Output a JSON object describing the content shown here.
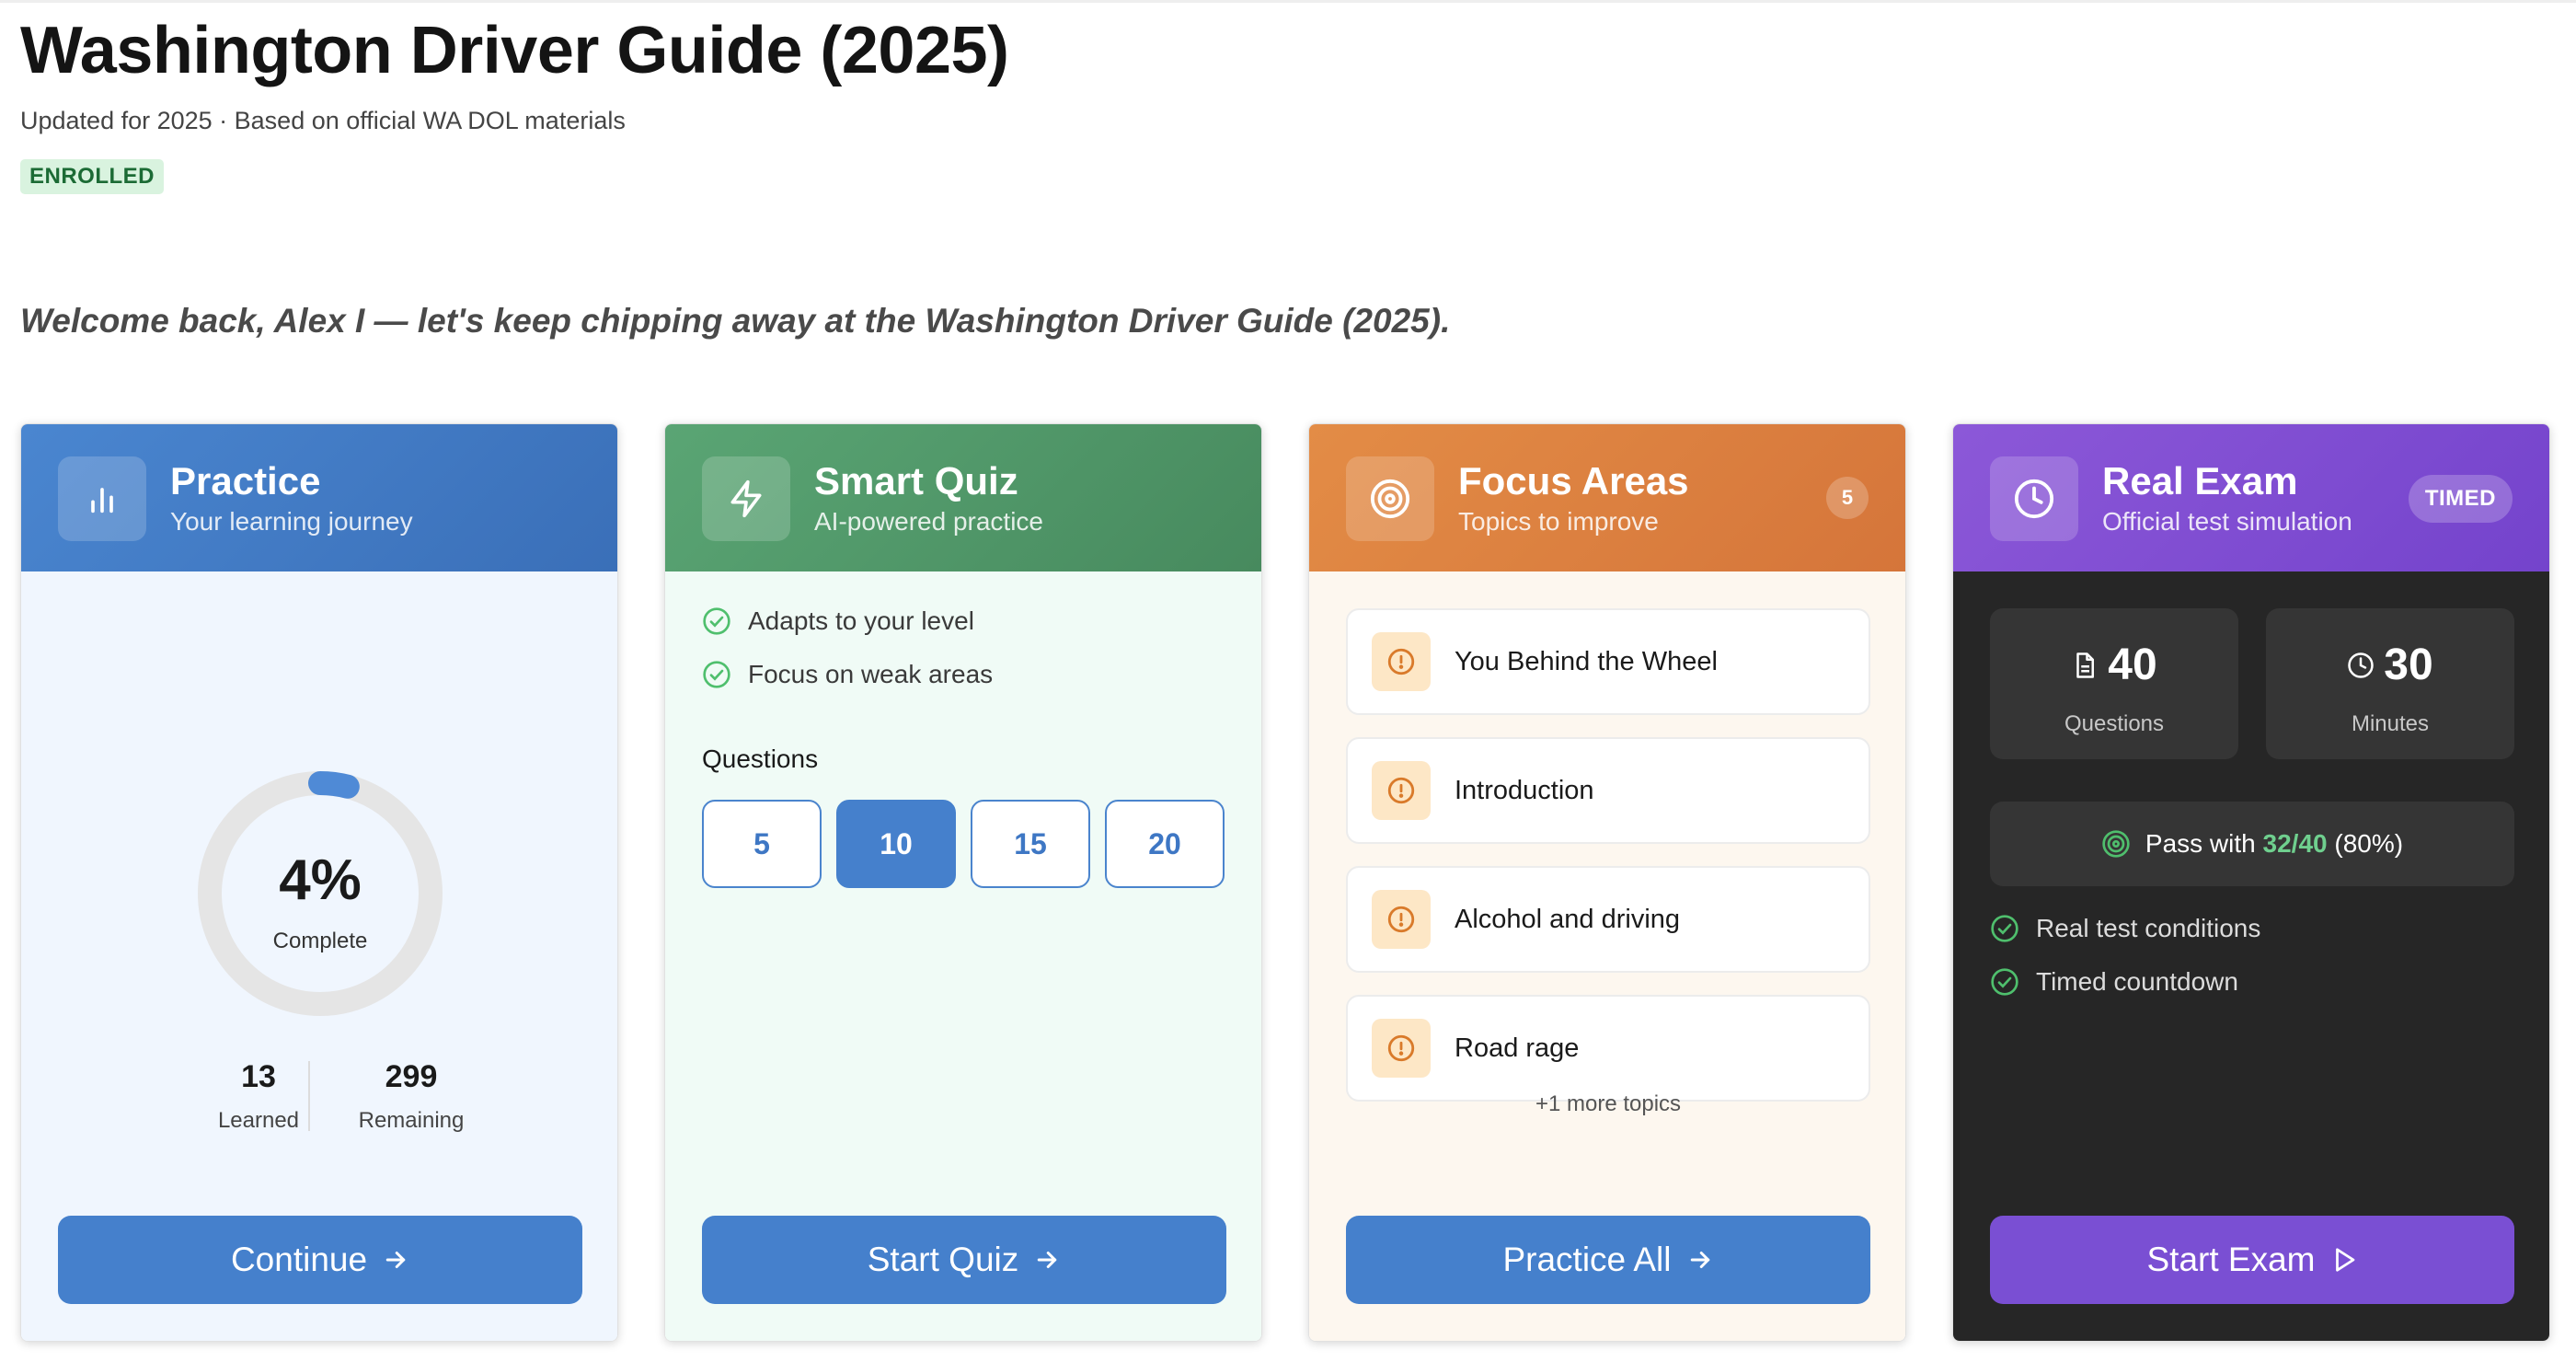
{
  "header": {
    "title": "Washington Driver Guide (2025)",
    "subtitle": "Updated for 2025 · Based on official WA DOL materials",
    "badge": "ENROLLED"
  },
  "welcome": "Welcome back, Alex I — let's keep chipping away at the Washington Driver Guide (2025).",
  "practice": {
    "title": "Practice",
    "subtitle": "Your learning journey",
    "percent_label": "4%",
    "percent_value": 4,
    "complete_label": "Complete",
    "learned_count": "13",
    "learned_label": "Learned",
    "remaining_count": "299",
    "remaining_label": "Remaining",
    "button": "Continue"
  },
  "smart_quiz": {
    "title": "Smart Quiz",
    "subtitle": "AI-powered practice",
    "features": [
      "Adapts to your level",
      "Focus on weak areas"
    ],
    "questions_label": "Questions",
    "options": [
      "5",
      "10",
      "15",
      "20"
    ],
    "selected": "10",
    "button": "Start Quiz"
  },
  "focus_areas": {
    "title": "Focus Areas",
    "subtitle": "Topics to improve",
    "count": "5",
    "topics": [
      "You Behind the Wheel",
      "Introduction",
      "Alcohol and driving",
      "Road rage"
    ],
    "more": "+1 more topics",
    "button": "Practice All"
  },
  "real_exam": {
    "title": "Real Exam",
    "subtitle": "Official test simulation",
    "badge": "TIMED",
    "questions_num": "40",
    "questions_label": "Questions",
    "minutes_num": "30",
    "minutes_label": "Minutes",
    "pass_prefix": "Pass with",
    "pass_score": "32/40",
    "pass_suffix": "(80%)",
    "features": [
      "Real test conditions",
      "Timed countdown"
    ],
    "button": "Start Exam"
  },
  "colors": {
    "practice": "#4a86d0",
    "smart_quiz": "#5aa574",
    "focus_areas": "#e38c46",
    "real_exam": "#8c58d8",
    "button_blue": "#4580cc",
    "button_purple": "#7a4fd3",
    "check_green": "#4fbf6d"
  },
  "icons": {
    "practice": "bar-chart-icon",
    "smart_quiz": "lightning-icon",
    "focus_areas": "target-icon",
    "real_exam": "clock-icon",
    "topic": "alert-circle-icon",
    "check": "check-circle-icon",
    "arrow": "arrow-right-icon",
    "play": "play-icon"
  }
}
